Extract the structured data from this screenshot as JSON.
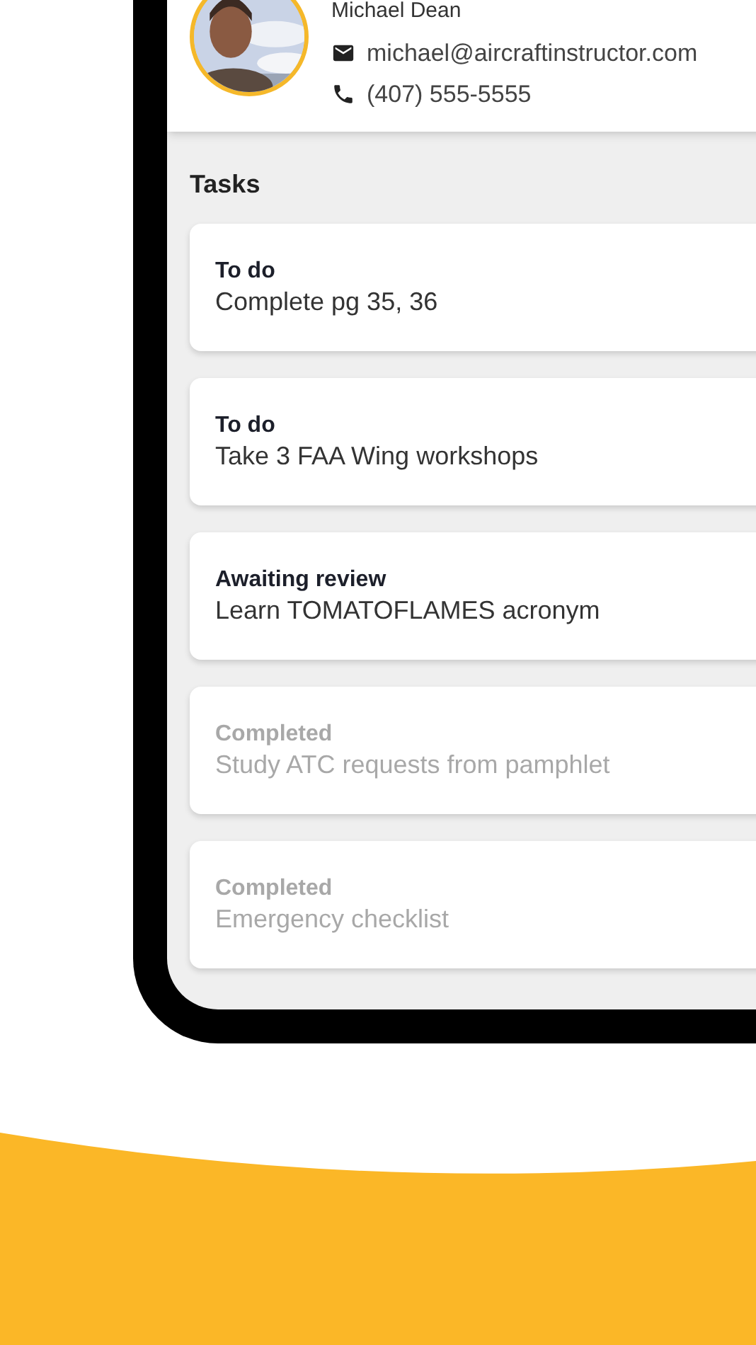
{
  "profile": {
    "name": "Michael Dean",
    "email": "michael@aircraftinstructor.com",
    "phone": "(407) 555-5555"
  },
  "tasks_title": "Tasks",
  "tasks": [
    {
      "status": "To do",
      "title": "Complete pg 35, 36",
      "completed": false
    },
    {
      "status": "To do",
      "title": "Take 3 FAA Wing workshops",
      "completed": false
    },
    {
      "status": "Awaiting review",
      "title": "Learn TOMATOFLAMES acronym",
      "completed": false
    },
    {
      "status": "Completed",
      "title": "Study ATC requests from pamphlet",
      "completed": true
    },
    {
      "status": "Completed",
      "title": "Emergency checklist",
      "completed": true
    }
  ]
}
